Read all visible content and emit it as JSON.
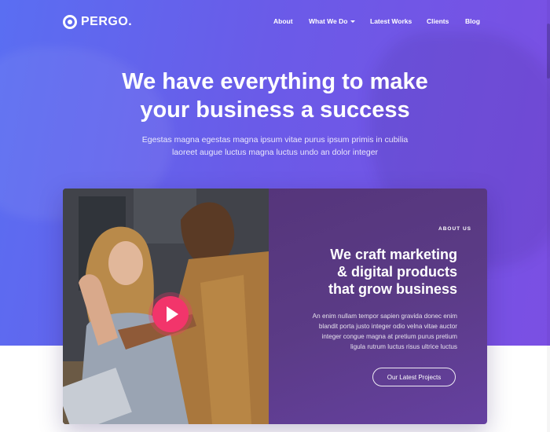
{
  "brand": {
    "name": "PERGO."
  },
  "nav": {
    "items": [
      {
        "label": "About"
      },
      {
        "label": "What We Do"
      },
      {
        "label": "Latest Works"
      },
      {
        "label": "Clients"
      },
      {
        "label": "Blog"
      }
    ]
  },
  "hero": {
    "headline_line1": "We have everything to make",
    "headline_line2": "your business a success",
    "sub_line1": "Egestas magna egestas magna ipsum vitae purus ipsum primis in cubilia",
    "sub_line2": "laoreet augue luctus magna luctus undo an dolor integer"
  },
  "about": {
    "label": "ABOUT US",
    "title_line1": "We craft marketing",
    "title_line2": "& digital products",
    "title_line3": "that grow business",
    "body_line1": "An enim nullam tempor sapien gravida donec enim",
    "body_line2": "blandit porta justo integer odio velna vitae auctor",
    "body_line3": "integer congue magna at pretium purus pretium",
    "body_line4": "ligula rutrum luctus risus ultrice luctus",
    "cta": "Our Latest Projects"
  },
  "colors": {
    "accent_play": "#f2356b",
    "hero_gradient_start": "#5a6ef2",
    "hero_gradient_end": "#7b4fe3",
    "panel": "#5b3b86"
  }
}
